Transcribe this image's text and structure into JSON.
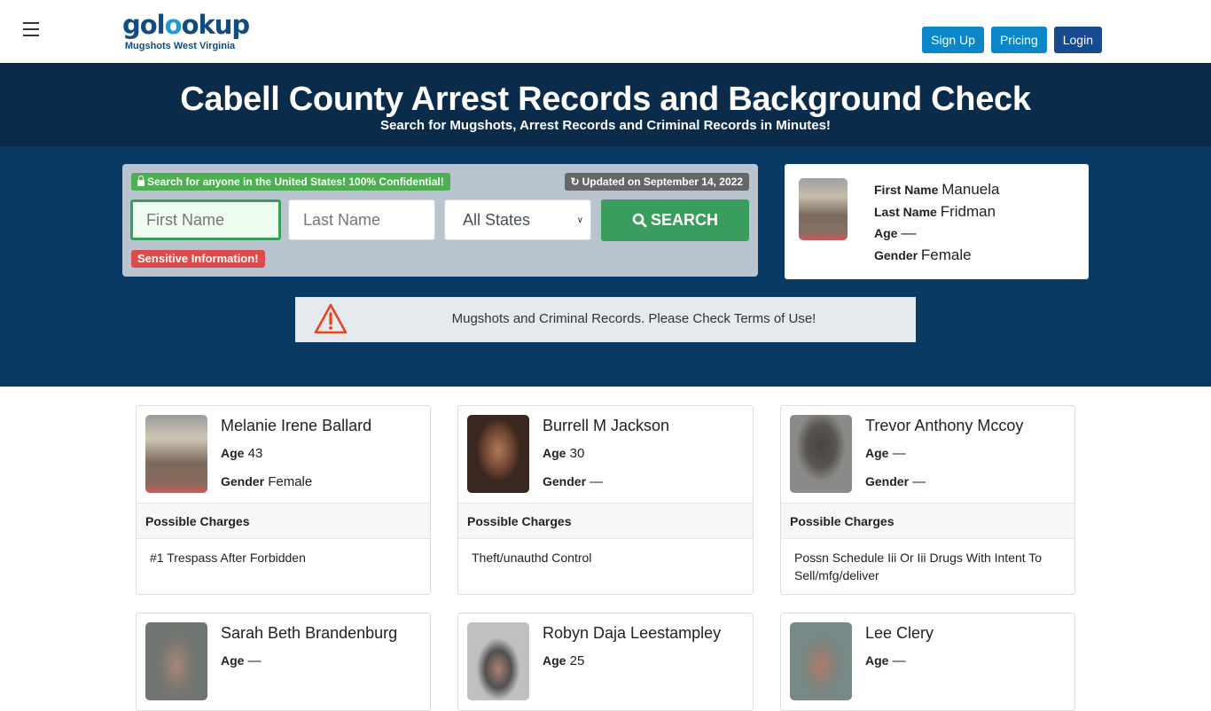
{
  "header": {
    "logo_word_pre": "gol",
    "logo_word_accent": "o",
    "logo_word_post": "okup",
    "logo_sub": "Mugshots West Virginia",
    "buttons": {
      "signup": "Sign Up",
      "pricing": "Pricing",
      "login": "Login"
    }
  },
  "hero": {
    "title": "Cabell County Arrest Records and Background Check",
    "subtitle": "Search for Mugshots, Arrest Records and Criminal Records in Minutes!"
  },
  "search": {
    "secure_badge": "Search for anyone in the United States! 100% Confidential!",
    "updated_badge": "Updated on September 14, 2022",
    "first_name_placeholder": "First Name",
    "last_name_placeholder": "Last Name",
    "state_selected": "All States",
    "search_button": "SEARCH",
    "sensitive_badge": "Sensitive Information!"
  },
  "featured": {
    "first_name_label": "First Name",
    "first_name": "Manuela",
    "last_name_label": "Last Name",
    "last_name": "Fridman",
    "age_label": "Age",
    "age": "—",
    "gender_label": "Gender",
    "gender": "Female"
  },
  "notice": {
    "text": "Mugshots and Criminal Records. Please Check Terms of Use!",
    "icon_color": "#e8431b"
  },
  "labels": {
    "age": "Age",
    "gender": "Gender",
    "possible_charges": "Possible Charges"
  },
  "records": [
    {
      "name": "Melanie Irene Ballard",
      "age": "43",
      "gender": "Female",
      "charges": "#1 Trespass After Forbidden"
    },
    {
      "name": "Burrell M Jackson",
      "age": "30",
      "gender": "—",
      "charges": "Theft/unauthd Control"
    },
    {
      "name": "Trevor Anthony Mccoy",
      "age": "—",
      "gender": "—",
      "charges": "Possn Schedule Iii Or Iii Drugs With Intent To Sell/mfg/deliver"
    },
    {
      "name": "Sarah Beth Brandenburg",
      "age": "—"
    },
    {
      "name": "Robyn Daja Leestampley",
      "age": "25"
    },
    {
      "name": "Lee Clery",
      "age": "—"
    }
  ],
  "colors": {
    "brand_dark": "#0b2b4a",
    "brand_blue": "#083a63",
    "success_green": "#3a9d5d",
    "danger_red": "#dc4c4c",
    "signup_blue": "#0b86c9",
    "login_navy": "#174a8f"
  }
}
